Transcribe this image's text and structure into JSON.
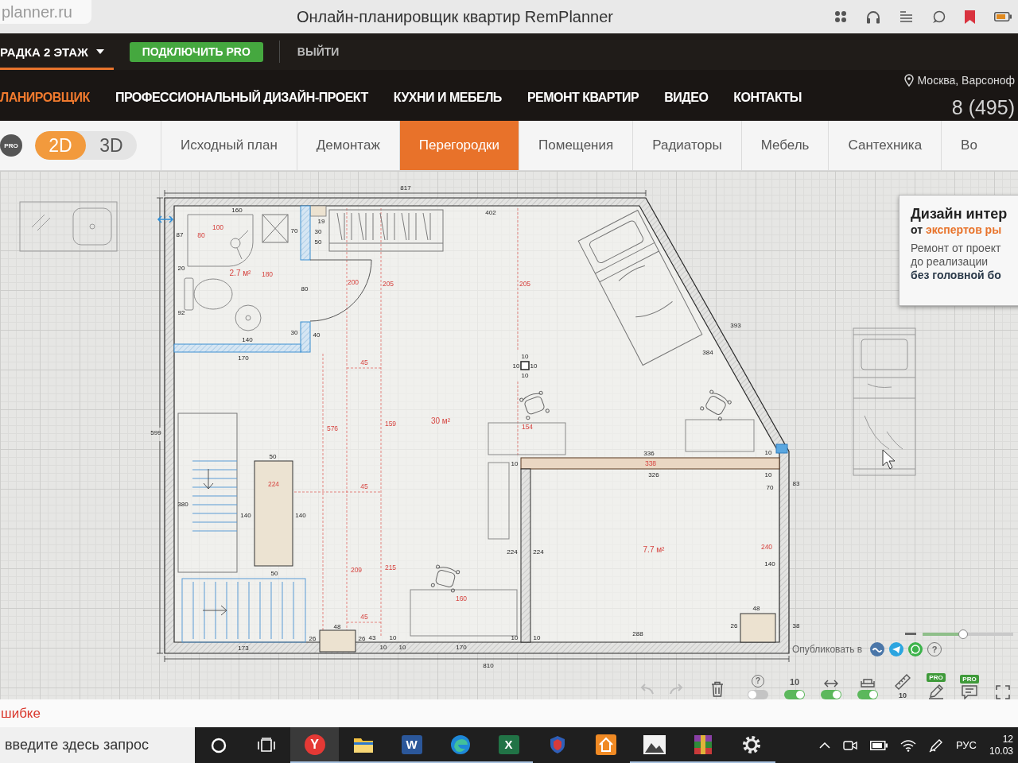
{
  "browser": {
    "tab_title": "planner.ru",
    "title": "Онлайн-планировщик квартир RemPlanner"
  },
  "top_bar": {
    "project": "РАДКА 2 ЭТАЖ",
    "pro_button": "ПОДКЛЮЧИТЬ PRO",
    "logout": "ВЫЙТИ"
  },
  "nav": {
    "items": [
      {
        "label": "ЛАНИРОВЩИК",
        "selected": true
      },
      {
        "label": "ПРОФЕССИОНАЛЬНЫЙ ДИЗАЙН-ПРОЕКТ",
        "selected": false
      },
      {
        "label": "КУХНИ И МЕБЕЛЬ",
        "selected": false
      },
      {
        "label": "РЕМОНТ КВАРТИР",
        "selected": false
      },
      {
        "label": "ВИДЕО",
        "selected": false
      },
      {
        "label": "КОНТАКТЫ",
        "selected": false
      }
    ],
    "location": "Москва, Варсоноф",
    "phone": "8 (495)"
  },
  "editor_bar": {
    "pro_badge": "PRO",
    "view_modes": [
      {
        "label": "2D",
        "selected": true
      },
      {
        "label": "3D",
        "selected": false
      }
    ],
    "tabs": [
      {
        "label": "Исходный план",
        "selected": false
      },
      {
        "label": "Демонтаж",
        "selected": false
      },
      {
        "label": "Перегородки",
        "selected": true
      },
      {
        "label": "Помещения",
        "selected": false
      },
      {
        "label": "Радиаторы",
        "selected": false
      },
      {
        "label": "Мебель",
        "selected": false
      },
      {
        "label": "Сантехника",
        "selected": false
      },
      {
        "label": "Во",
        "selected": false
      }
    ]
  },
  "plan": {
    "labels": [
      {
        "text": "817",
        "kind": "dim"
      },
      {
        "text": "402",
        "kind": "dim"
      },
      {
        "text": "160",
        "kind": "dim"
      },
      {
        "text": "100",
        "kind": "guide"
      },
      {
        "text": "87",
        "kind": "dim"
      },
      {
        "text": "80",
        "kind": "guide"
      },
      {
        "text": "70",
        "kind": "dim"
      },
      {
        "text": "19",
        "kind": "dim"
      },
      {
        "text": "30",
        "kind": "dim"
      },
      {
        "text": "50",
        "kind": "dim"
      },
      {
        "text": "20",
        "kind": "dim"
      },
      {
        "text": "2.7 м²",
        "kind": "area"
      },
      {
        "text": "180",
        "kind": "guide"
      },
      {
        "text": "80",
        "kind": "dim"
      },
      {
        "text": "92",
        "kind": "dim"
      },
      {
        "text": "30",
        "kind": "dim"
      },
      {
        "text": "40",
        "kind": "dim"
      },
      {
        "text": "140",
        "kind": "dim"
      },
      {
        "text": "170",
        "kind": "dim"
      },
      {
        "text": "200",
        "kind": "guide"
      },
      {
        "text": "205",
        "kind": "guide"
      },
      {
        "text": "205",
        "kind": "guide"
      },
      {
        "text": "45",
        "kind": "guide"
      },
      {
        "text": "10",
        "kind": "dim"
      },
      {
        "text": "10",
        "kind": "dim"
      },
      {
        "text": "10",
        "kind": "dim"
      },
      {
        "text": "10",
        "kind": "dim"
      },
      {
        "text": "393",
        "kind": "dim"
      },
      {
        "text": "384",
        "kind": "dim"
      },
      {
        "text": "599",
        "kind": "dim"
      },
      {
        "text": "576",
        "kind": "guide"
      },
      {
        "text": "159",
        "kind": "guide"
      },
      {
        "text": "30 м²",
        "kind": "area"
      },
      {
        "text": "154",
        "kind": "guide"
      },
      {
        "text": "50",
        "kind": "dim"
      },
      {
        "text": "224",
        "kind": "guide"
      },
      {
        "text": "45",
        "kind": "guide"
      },
      {
        "text": "380",
        "kind": "dim"
      },
      {
        "text": "140",
        "kind": "dim"
      },
      {
        "text": "140",
        "kind": "dim"
      },
      {
        "text": "50",
        "kind": "dim"
      },
      {
        "text": "209",
        "kind": "guide"
      },
      {
        "text": "215",
        "kind": "guide"
      },
      {
        "text": "160",
        "kind": "guide"
      },
      {
        "text": "45",
        "kind": "guide"
      },
      {
        "text": "48",
        "kind": "dim"
      },
      {
        "text": "26",
        "kind": "dim"
      },
      {
        "text": "26",
        "kind": "dim"
      },
      {
        "text": "43",
        "kind": "dim"
      },
      {
        "text": "10",
        "kind": "dim"
      },
      {
        "text": "10",
        "kind": "dim"
      },
      {
        "text": "10",
        "kind": "dim"
      },
      {
        "text": "170",
        "kind": "dim"
      },
      {
        "text": "10",
        "kind": "dim"
      },
      {
        "text": "10",
        "kind": "dim"
      },
      {
        "text": "173",
        "kind": "dim"
      },
      {
        "text": "810",
        "kind": "dim"
      },
      {
        "text": "336",
        "kind": "dim"
      },
      {
        "text": "338",
        "kind": "guide"
      },
      {
        "text": "326",
        "kind": "dim"
      },
      {
        "text": "10",
        "kind": "dim"
      },
      {
        "text": "10",
        "kind": "dim"
      },
      {
        "text": "10",
        "kind": "dim"
      },
      {
        "text": "224",
        "kind": "dim"
      },
      {
        "text": "224",
        "kind": "dim"
      },
      {
        "text": "7.7 м²",
        "kind": "area"
      },
      {
        "text": "70",
        "kind": "dim"
      },
      {
        "text": "83",
        "kind": "dim"
      },
      {
        "text": "240",
        "kind": "guide"
      },
      {
        "text": "140",
        "kind": "dim"
      },
      {
        "text": "48",
        "kind": "dim"
      },
      {
        "text": "26",
        "kind": "dim"
      },
      {
        "text": "38",
        "kind": "dim"
      },
      {
        "text": "288",
        "kind": "dim"
      }
    ]
  },
  "ad": {
    "title": "Дизайн интер",
    "subtitle": "от",
    "subtitle_highlight": "экспертов ры",
    "lines": [
      "Ремонт от проект",
      "до реализации",
      "**без головной бо**"
    ]
  },
  "share": {
    "label": "Опубликовать в",
    "help": "?"
  },
  "zoom": {
    "level": 0.45
  },
  "toolbar": {
    "undo": {
      "disabled": true
    },
    "redo": {
      "disabled": true
    },
    "switches": [
      {
        "kind": "help",
        "glyph": "?",
        "on": false
      },
      {
        "kind": "dimension",
        "label": "10",
        "on": true
      },
      {
        "kind": "width",
        "on": true
      },
      {
        "kind": "furniture",
        "on": true
      }
    ],
    "tools": [
      {
        "kind": "ruler",
        "label": "10"
      },
      {
        "kind": "pencil",
        "badge": "PRO"
      },
      {
        "kind": "comment",
        "badge": "PRO"
      },
      {
        "kind": "fullscreen"
      }
    ]
  },
  "footer": {
    "link": "шибке"
  },
  "taskbar": {
    "search": {
      "placeholder": "введите здесь запрос"
    },
    "apps": [
      {
        "kind": "browser",
        "glyph": "Y",
        "selected": true,
        "running": true
      },
      {
        "kind": "folder",
        "selected": false,
        "running": true
      },
      {
        "kind": "document",
        "glyph": "W",
        "selected": false,
        "running": true
      },
      {
        "kind": "swirl",
        "selected": false,
        "running": true
      },
      {
        "kind": "spreadsheet",
        "glyph": "X",
        "selected": false,
        "running": true
      },
      {
        "kind": "shield",
        "selected": false,
        "running": false
      },
      {
        "kind": "house",
        "selected": false,
        "running": false
      },
      {
        "kind": "picture",
        "selected": false,
        "running": true
      },
      {
        "kind": "archive",
        "selected": false,
        "running": true
      },
      {
        "kind": "gear",
        "selected": false,
        "running": true
      }
    ],
    "tray": {
      "language": "РУС",
      "time": "12",
      "date": "10.03"
    }
  }
}
